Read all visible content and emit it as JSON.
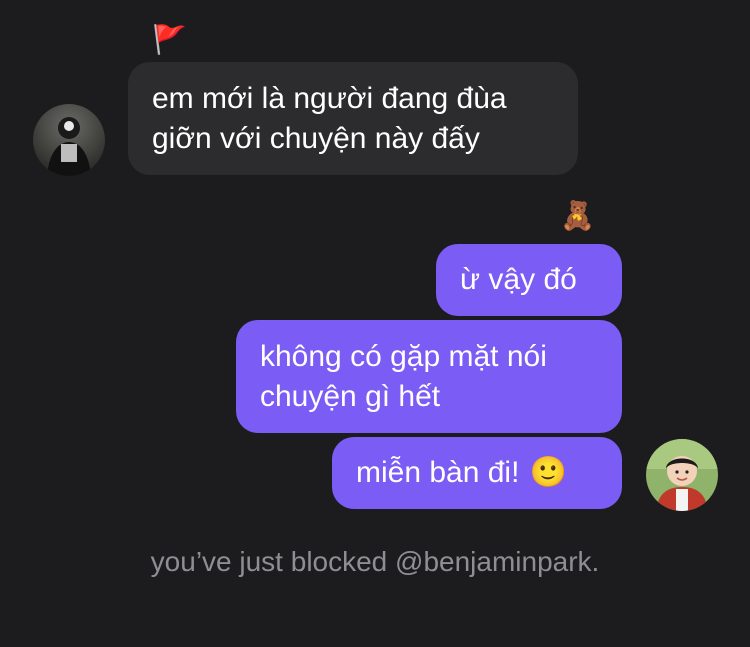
{
  "conversation": {
    "incoming": {
      "reaction": "🚩",
      "avatar_icon": "user-avatar-dark",
      "message": "em mới là người đang đùa\ngiỡn với chuyện này đấy"
    },
    "outgoing": {
      "reaction": "🧸",
      "avatar_icon": "user-avatar-child",
      "messages": [
        "ừ vậy đó",
        "không có gặp mặt nói\nchuyện gì hết",
        "miễn bàn đi!"
      ],
      "last_emoji": "🙂"
    },
    "system_notice": "you’ve just blocked @benjaminpark."
  },
  "colors": {
    "background": "#1c1c1e",
    "incoming_bubble": "#2c2c2e",
    "outgoing_bubble": "#7b5cf5",
    "system_text": "#8e8e93"
  }
}
